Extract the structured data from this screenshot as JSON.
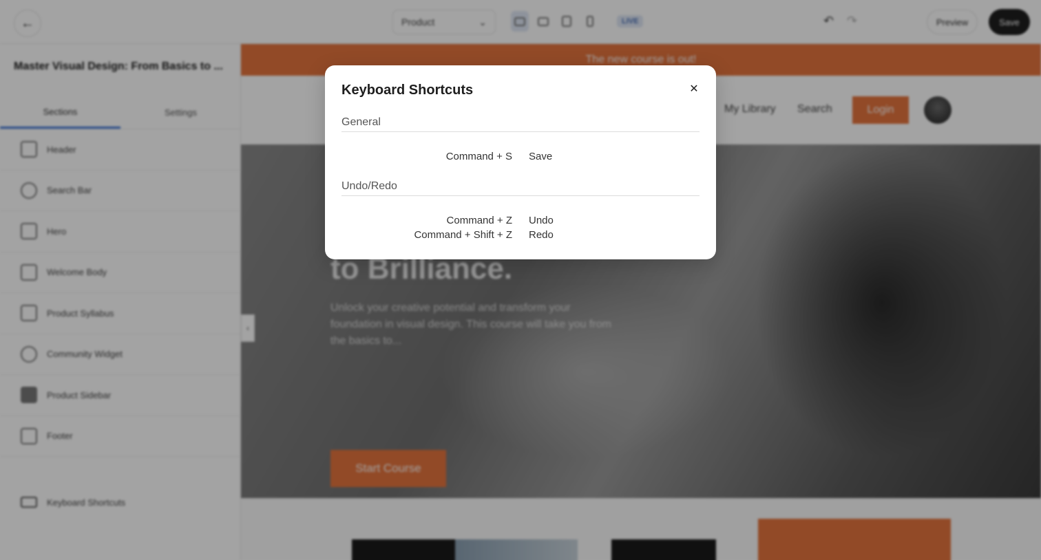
{
  "topbar": {
    "back_icon": "back-arrow-icon",
    "page_select_value": "Product",
    "live_badge": "LIVE",
    "preview_label": "Preview",
    "save_label": "Save"
  },
  "sidebar": {
    "course_title": "Master Visual Design: From Basics to ...",
    "tabs": [
      {
        "label": "Sections"
      },
      {
        "label": "Settings"
      }
    ],
    "sections": [
      {
        "label": "Header",
        "icon": "header-icon"
      },
      {
        "label": "Search Bar",
        "icon": "search-icon"
      },
      {
        "label": "Hero",
        "icon": "image-icon"
      },
      {
        "label": "Welcome Body",
        "icon": "layout-icon"
      },
      {
        "label": "Product Syllabus",
        "icon": "list-icon"
      },
      {
        "label": "Community Widget",
        "icon": "chat-icon"
      },
      {
        "label": "Product Sidebar",
        "icon": "sidebar-icon"
      },
      {
        "label": "Footer",
        "icon": "footer-icon"
      }
    ],
    "keyboard_shortcuts_label": "Keyboard Shortcuts"
  },
  "canvas": {
    "announcement": "The new course is out!",
    "nav": {
      "library": "My Library",
      "search": "Search",
      "login": "Login"
    },
    "hero": {
      "heading": "to Brilliance.",
      "text": "Unlock your creative potential and transform your foundation in visual design. This course will take you from the basics to...",
      "button": "Start Course"
    }
  },
  "modal": {
    "title": "Keyboard Shortcuts",
    "close_icon": "close-icon",
    "groups": [
      {
        "title": "General",
        "shortcuts": [
          {
            "keys": "Command + S",
            "action": "Save"
          }
        ]
      },
      {
        "title": "Undo/Redo",
        "shortcuts": [
          {
            "keys": "Command + Z",
            "action": "Undo"
          },
          {
            "keys": "Command + Shift + Z",
            "action": "Redo"
          }
        ]
      }
    ]
  }
}
